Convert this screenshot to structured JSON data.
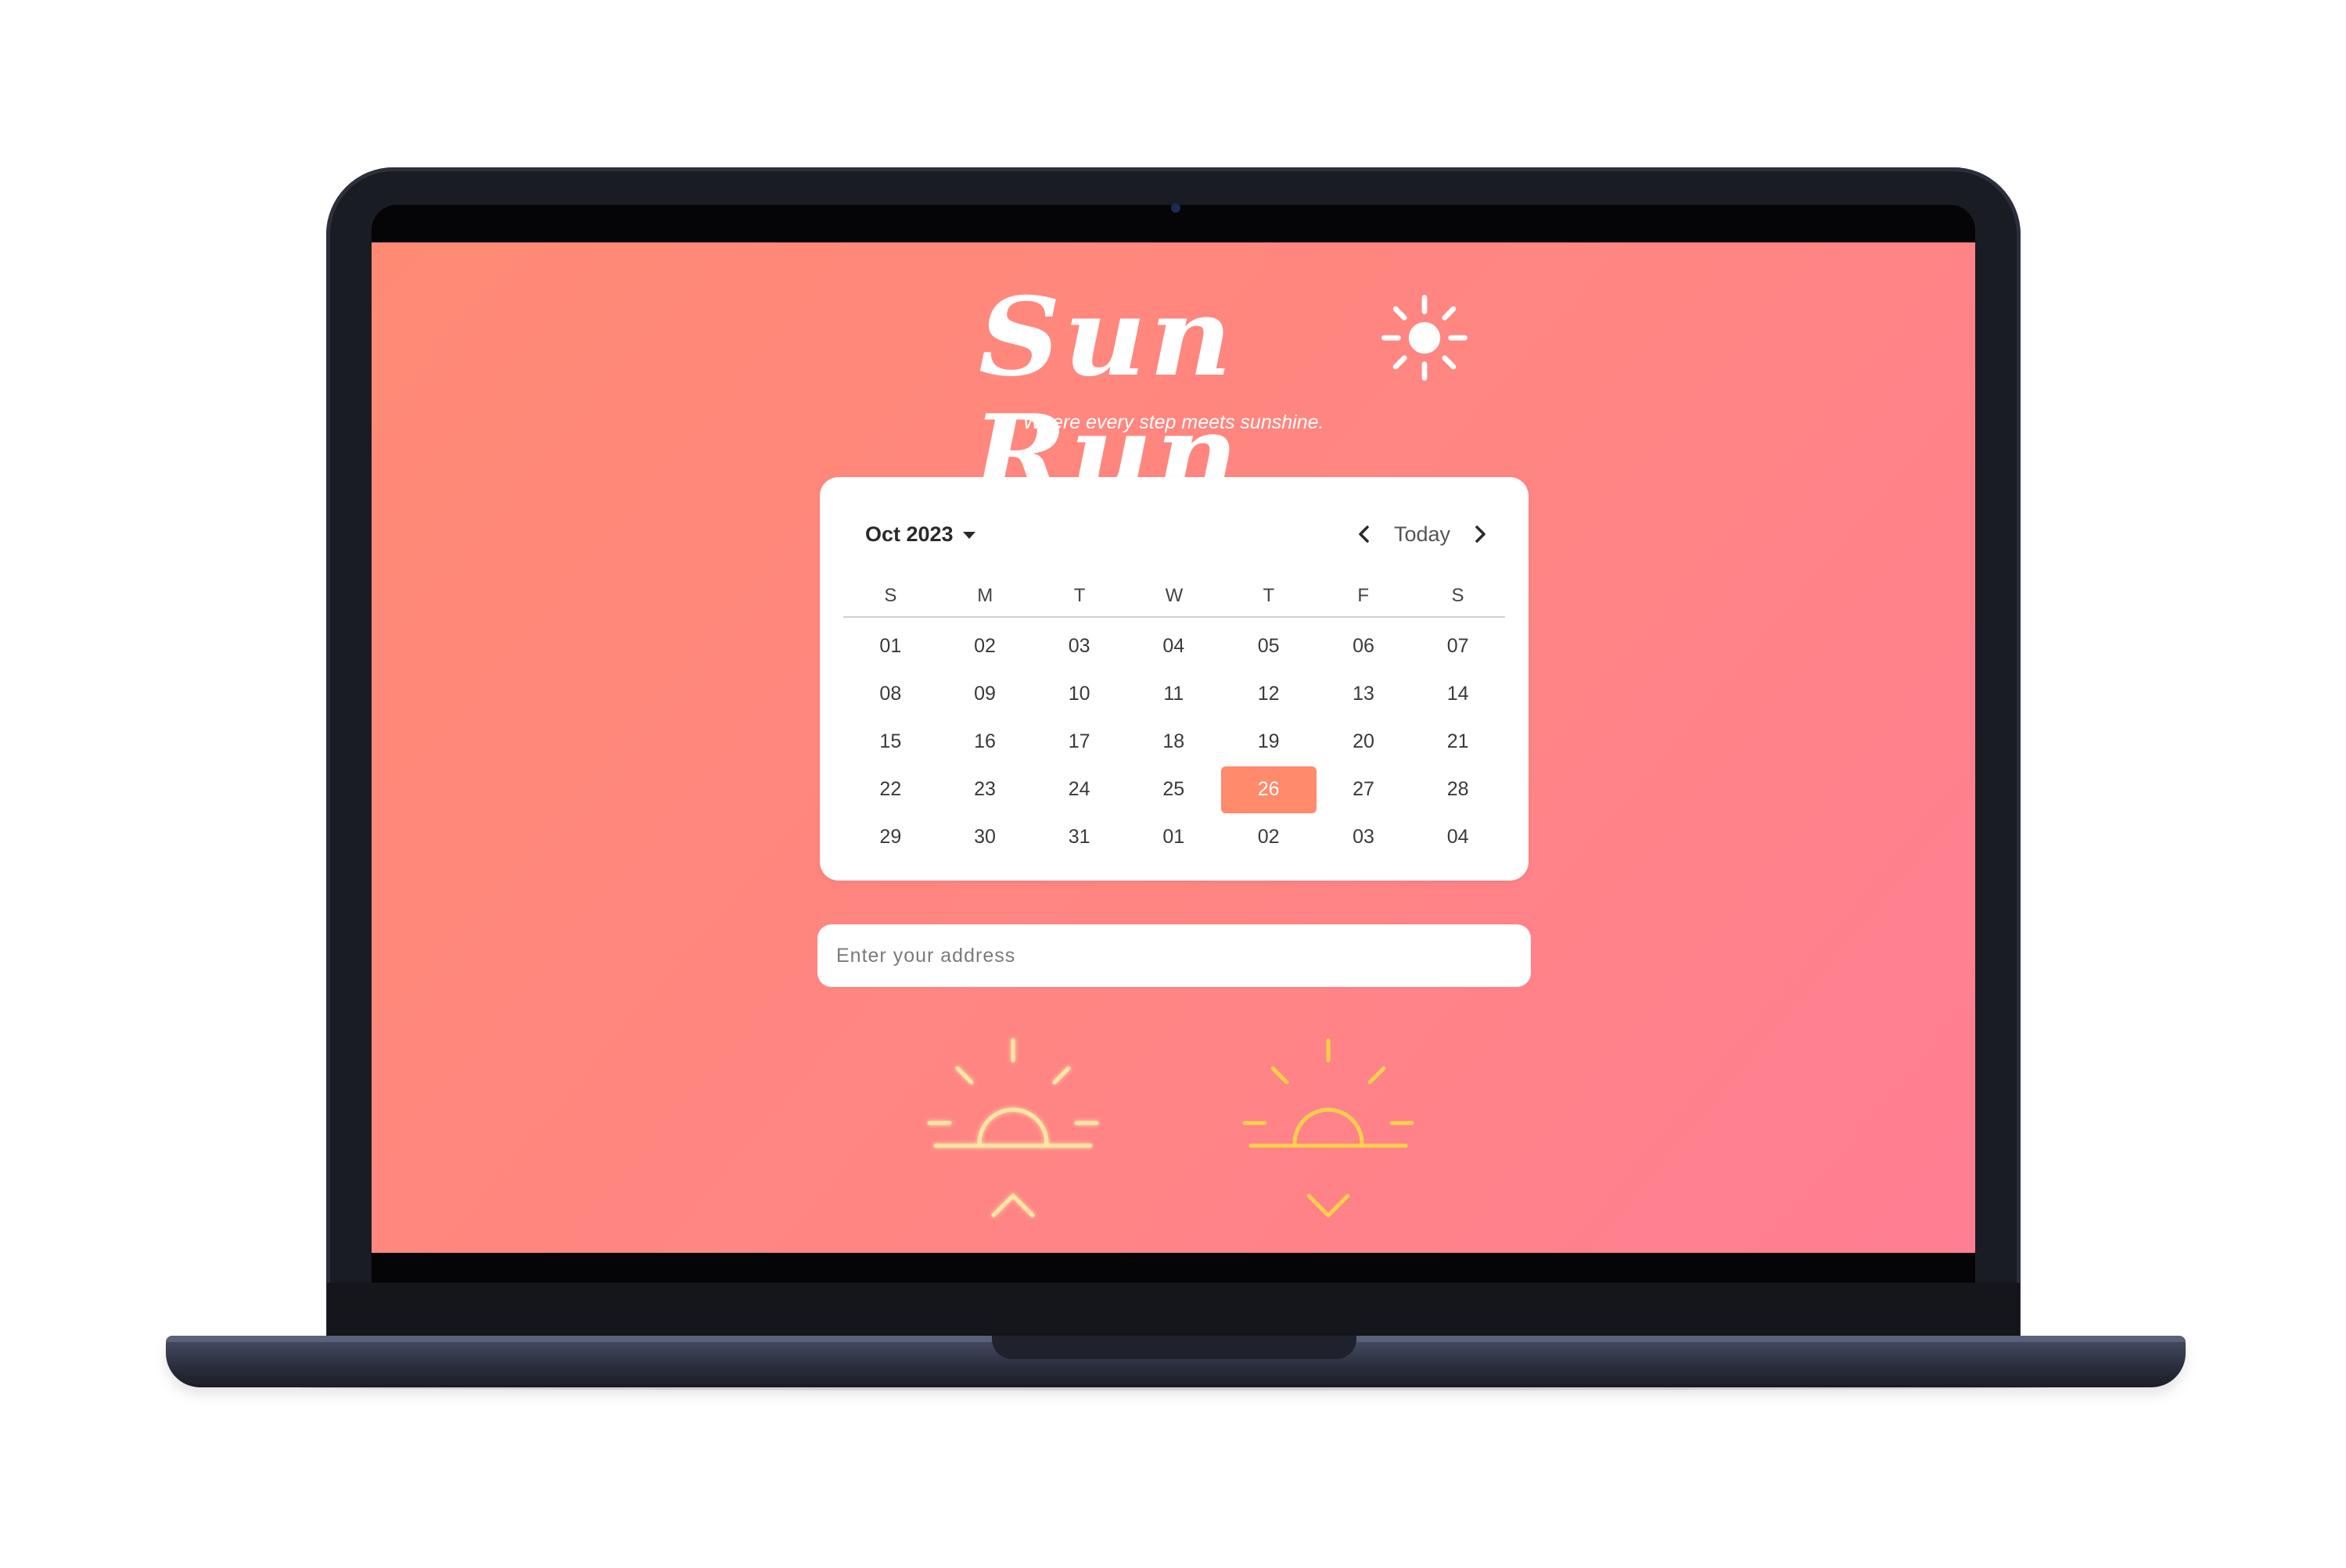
{
  "app": {
    "logo_text": "Sun Run",
    "tagline": "Where every step meets sunshine."
  },
  "calendar": {
    "month_label": "Oct 2023",
    "today_label": "Today",
    "weekdays": [
      "S",
      "M",
      "T",
      "W",
      "T",
      "F",
      "S"
    ],
    "days": [
      "01",
      "02",
      "03",
      "04",
      "05",
      "06",
      "07",
      "08",
      "09",
      "10",
      "11",
      "12",
      "13",
      "14",
      "15",
      "16",
      "17",
      "18",
      "19",
      "20",
      "21",
      "22",
      "23",
      "24",
      "25",
      "26",
      "27",
      "28",
      "29",
      "30",
      "31",
      "01",
      "02",
      "03",
      "04"
    ],
    "selected_day": "26"
  },
  "address": {
    "placeholder": "Enter your address",
    "value": ""
  },
  "icons": {
    "logo_sun": "sun-icon",
    "prev": "chevron-left-icon",
    "next": "chevron-right-icon",
    "month_dropdown": "caret-down-icon",
    "sunrise": "sunrise-icon",
    "sunset": "sunset-icon"
  },
  "colors": {
    "background_start": "#ff8a74",
    "background_end": "#ff7e93",
    "selected_day": "#ff8a6c",
    "sunrise_icon": "#ffe7a6",
    "sunset_icon": "#ffd24a"
  }
}
